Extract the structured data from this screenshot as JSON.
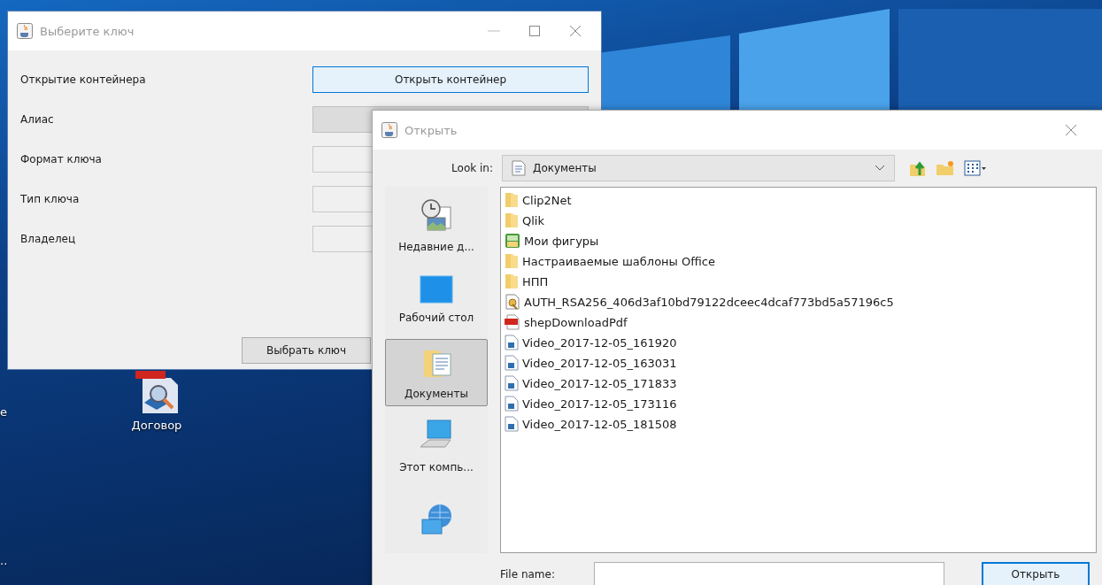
{
  "desktop": {
    "icons": [
      {
        "label": "Договор",
        "kind": "pdf"
      }
    ],
    "edge_labels": [
      "e",
      ".."
    ]
  },
  "key_window": {
    "title": "Выберите ключ",
    "open_row": {
      "label": "Открытие контейнера",
      "button": "Открыть контейнер"
    },
    "fields": [
      {
        "label": "Алиас",
        "disabled": true
      },
      {
        "label": "Формат ключа",
        "disabled": false
      },
      {
        "label": "Тип ключа",
        "disabled": false
      },
      {
        "label": "Владелец",
        "disabled": false
      }
    ],
    "select_button": "Выбрать ключ"
  },
  "open_dialog": {
    "title": "Открыть",
    "look_in": {
      "label": "Look in:",
      "value": "Документы"
    },
    "places": [
      {
        "label": "Недавние д...",
        "kind": "recent",
        "selected": false
      },
      {
        "label": "Рабочий стол",
        "kind": "desktop",
        "selected": false
      },
      {
        "label": "Документы",
        "kind": "documents",
        "selected": true
      },
      {
        "label": "Этот компь...",
        "kind": "computer",
        "selected": false
      },
      {
        "kind": "network",
        "selected": false
      }
    ],
    "files": [
      {
        "name": "Clip2Net",
        "kind": "folder"
      },
      {
        "name": "Qlik",
        "kind": "folder"
      },
      {
        "name": "Мои фигуры",
        "kind": "library"
      },
      {
        "name": "Настраиваемые шаблоны Office",
        "kind": "folder"
      },
      {
        "name": "НПП",
        "kind": "folder"
      },
      {
        "name": "AUTH_RSA256_406d3af10bd79122dceec4dcaf773bd5a57196c5",
        "kind": "certificate"
      },
      {
        "name": "shepDownloadPdf",
        "kind": "pdf"
      },
      {
        "name": "Video_2017-12-05_161920",
        "kind": "file"
      },
      {
        "name": "Video_2017-12-05_163031",
        "kind": "file"
      },
      {
        "name": "Video_2017-12-05_171833",
        "kind": "file"
      },
      {
        "name": "Video_2017-12-05_173116",
        "kind": "file"
      },
      {
        "name": "Video_2017-12-05_181508",
        "kind": "file"
      }
    ],
    "file_name": {
      "label": "File name:"
    },
    "open_button": "Открыть"
  }
}
